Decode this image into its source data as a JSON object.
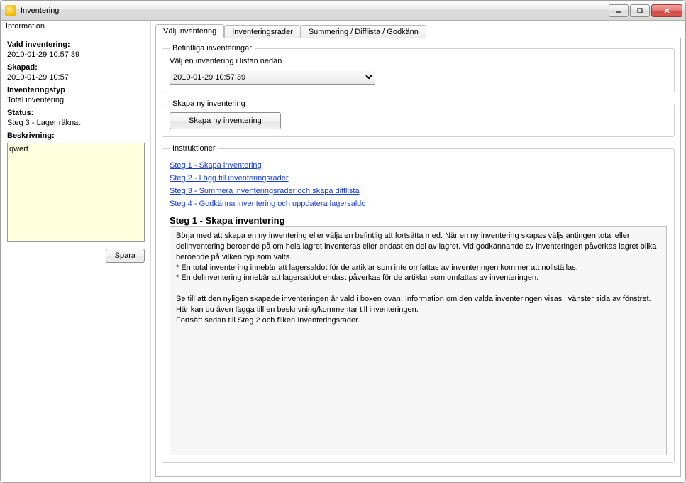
{
  "window": {
    "title": "Inventering"
  },
  "left": {
    "section_title": "Information",
    "vald_label": "Vald inventering:",
    "vald_value": "2010-01-29 10:57:39",
    "skapad_label": "Skapad:",
    "skapad_value": "2010-01-29 10:57",
    "typ_label": "Inventeringstyp",
    "typ_value": "Total inventering",
    "status_label": "Status:",
    "status_value": "Steg 3 - Lager räknat",
    "beskrivning_label": "Beskrivning:",
    "beskrivning_value": "qwert",
    "save_label": "Spara"
  },
  "tabs": [
    {
      "label": "Välj inventering"
    },
    {
      "label": "Inventeringsrader"
    },
    {
      "label": "Summering / Difflista / Godkänn"
    }
  ],
  "befintliga": {
    "legend": "Befintliga inventeringar",
    "instruction": "Välj en inventering i listan nedan",
    "selected": "2010-01-29 10:57:39"
  },
  "skapa": {
    "legend": "Skapa ny inventering",
    "button": "Skapa ny inventering"
  },
  "instruktioner": {
    "legend": "Instruktioner",
    "links": [
      "Steg 1 - Skapa inventering",
      "Steg 2 - Lägg till inventeringsrader",
      "Steg 3 - Summera inventeringsrader och skapa difflista",
      "Steg 4 - Godkänna inventering och uppdatera lagersaldo"
    ],
    "header": "Steg 1 - Skapa inventering",
    "body": "Börja med att skapa en ny inventering eller välja en befintlig att fortsätta med. När en ny inventering skapas väljs antingen total eller delinventering beroende på om hela lagret inventeras eller endast en del av lagret. Vid godkännande av inventeringen påverkas lagret olika beroende på vilken typ som valts.\n* En total inventering innebär att lagersaldot för de artiklar som inte omfattas av inventeringen kommer att nollställas.\n* En delinventering innebär att lagersaldot endast påverkas för de artiklar som omfattas av inventeringen.\n\nSe till att den nyligen skapade inventeringen är vald i boxen ovan. Information om den valda inventeringen visas i vänster sida av fönstret. Här kan du även lägga till en beskrivning/kommentar till inventeringen.\nFortsätt sedan till Steg 2 och fliken Inventeringsrader."
  }
}
